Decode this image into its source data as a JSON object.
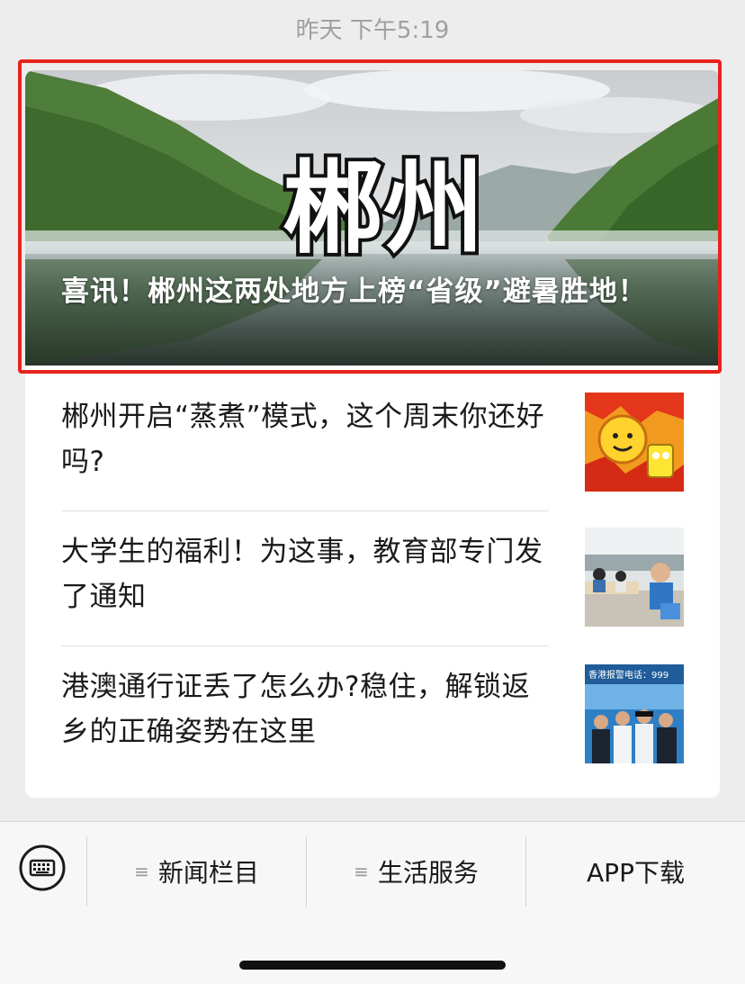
{
  "timestamp": "昨天 下午5:19",
  "hero": {
    "logo_text": "郴州",
    "title": "喜讯！郴州这两处地方上榜“省级”避暑胜地！"
  },
  "news": [
    {
      "title": "郴州开启“蒸煮”模式，这个周末你还好吗?",
      "thumb": "sun-cartoon-thumbnail"
    },
    {
      "title": "大学生的福利！为这事，教育部专门发了通知",
      "thumb": "classroom-students-thumbnail"
    },
    {
      "title": "港澳通行证丢了怎么办?稳住，解锁返乡的正确姿势在这里",
      "thumb": "hk-police-thumbnail",
      "thumb_caption": "香港报警电话：999"
    }
  ],
  "menu": {
    "keyboard_icon": "keyboard-icon",
    "items": [
      {
        "label": "新闻栏目",
        "glyph": "≡"
      },
      {
        "label": "生活服务",
        "glyph": "≡"
      },
      {
        "label": "APP下载",
        "glyph": ""
      }
    ]
  },
  "colors": {
    "highlight": "#e8231b",
    "background": "#ededed"
  }
}
